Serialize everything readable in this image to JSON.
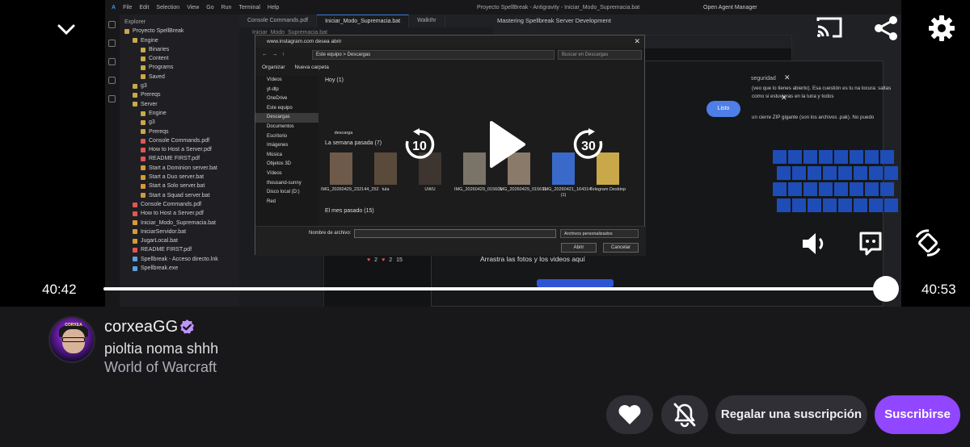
{
  "ide": {
    "menu": [
      "File",
      "Edit",
      "Selection",
      "View",
      "Go",
      "Run",
      "Terminal",
      "Help"
    ],
    "window_title": "Proyecto SpellBreak - Antigravity - Iniciar_Modo_Supremacia.bat",
    "agent_manager": "Open Agent Manager",
    "explorer_header": "Explorer",
    "explorer_items": [
      {
        "label": "Proyecto SpellBreak",
        "indent": 0,
        "kind": "folder"
      },
      {
        "label": "Engine",
        "indent": 1,
        "kind": "folder"
      },
      {
        "label": "Binaries",
        "indent": 2,
        "kind": "folder"
      },
      {
        "label": "Content",
        "indent": 2,
        "kind": "folder"
      },
      {
        "label": "Programs",
        "indent": 2,
        "kind": "folder"
      },
      {
        "label": "Saved",
        "indent": 2,
        "kind": "folder"
      },
      {
        "label": "g3",
        "indent": 1,
        "kind": "folder"
      },
      {
        "label": "Prereqs",
        "indent": 1,
        "kind": "folder"
      },
      {
        "label": "Server",
        "indent": 1,
        "kind": "folder-open"
      },
      {
        "label": "Engine",
        "indent": 2,
        "kind": "folder"
      },
      {
        "label": "g3",
        "indent": 2,
        "kind": "folder"
      },
      {
        "label": "Prereqs",
        "indent": 2,
        "kind": "folder"
      },
      {
        "label": "Console Commands.pdf",
        "indent": 2,
        "kind": "pdf"
      },
      {
        "label": "How to Host a Server.pdf",
        "indent": 2,
        "kind": "pdf"
      },
      {
        "label": "README FIRST.pdf",
        "indent": 2,
        "kind": "pdf"
      },
      {
        "label": "Start a Dominion server.bat",
        "indent": 2,
        "kind": "bat"
      },
      {
        "label": "Start a Duo server.bat",
        "indent": 2,
        "kind": "bat"
      },
      {
        "label": "Start a Solo server.bat",
        "indent": 2,
        "kind": "bat"
      },
      {
        "label": "Start a Squad server.bat",
        "indent": 2,
        "kind": "bat"
      },
      {
        "label": "Console Commands.pdf",
        "indent": 1,
        "kind": "pdf"
      },
      {
        "label": "How to Host a Server.pdf",
        "indent": 1,
        "kind": "pdf"
      },
      {
        "label": "Iniciar_Modo_Supremacia.bat",
        "indent": 1,
        "kind": "bat"
      },
      {
        "label": "IniciarServidor.bat",
        "indent": 1,
        "kind": "bat"
      },
      {
        "label": "JugarLocal.bat",
        "indent": 1,
        "kind": "bat"
      },
      {
        "label": "README FIRST.pdf",
        "indent": 1,
        "kind": "pdf"
      },
      {
        "label": "Spellbreak - Acceso directo.lnk",
        "indent": 1,
        "kind": "lnk"
      },
      {
        "label": "Spellbreak.exe",
        "indent": 1,
        "kind": "exe"
      }
    ],
    "tabs": [
      "Console Commands.pdf",
      "Iniciar_Modo_Supremacia.bat",
      "Walkthr"
    ],
    "breadcrumb": "Iniciar_Modo_Supremacia.bat",
    "right_heading": "Mastering Spellbreak Server Development",
    "right_text": "(veo que lo tienes abierto). Esa cuestión es tu na locura: saltas como si estuvieras en la luna y todos",
    "zip_text": "un cierre ZIP gigante (son los archivos .pak). No puedo",
    "colors": {
      "accent": "#3a7bd5",
      "pdf": "#e25555",
      "bat": "#d49a3a",
      "folder": "#c9a84a",
      "exe": "#5ba0e0"
    }
  },
  "browser": {
    "url": "www.instagram.com desea abrir",
    "drop_text": "Arrastra las fotos y los videos aquí",
    "listo_label": "Listo",
    "security_tab": "seguridad",
    "likes": "2",
    "hearts": "2",
    "count": "15"
  },
  "file_dialog": {
    "title": "www.instagram.com desea abrir",
    "path": [
      "Este equipo",
      "Descargas"
    ],
    "search_placeholder": "Buscar en Descargas",
    "organize_label": "Organizar",
    "new_folder_label": "Nueva carpeta",
    "nav_items": [
      "Vídeos",
      "yt-dlp",
      "OneDrive",
      "Este equipo",
      "Descargas",
      "Documentos",
      "Escritorio",
      "Imágenes",
      "Música",
      "Objetos 3D",
      "Vídeos",
      "thousand-sunny",
      "Disco local (D:)",
      "Red"
    ],
    "groups": [
      "Hoy (1)",
      "La semana pasada (7)",
      "El mes pasado (15)"
    ],
    "today_item": "descarga",
    "files": [
      "IMG_20260429_232144_252",
      "tula",
      "UWU",
      "IMG_20260429_015601",
      "IMG_20260429_015611",
      "IMG_20260421_164314 (1)",
      "Telegram Desktop"
    ],
    "filename_label": "Nombre de archivo:",
    "filetype_value": "Archivos personalizados",
    "open_button": "Abrir",
    "cancel_button": "Cancelar"
  },
  "player": {
    "rewind_seconds": "10",
    "forward_seconds": "30",
    "current_time": "40:42",
    "end_time": "40:53",
    "progress_fraction": 0.996
  },
  "channel": {
    "name": "corxeaGG",
    "title": "pioltia noma shhh",
    "category": "World of Warcraft",
    "gift_label": "Regalar una suscripción",
    "subscribe_label": "Suscribirse",
    "avatar_text": "CORXEA",
    "verified_color": "#bf94ff",
    "subscribe_color": "#9147ff"
  }
}
